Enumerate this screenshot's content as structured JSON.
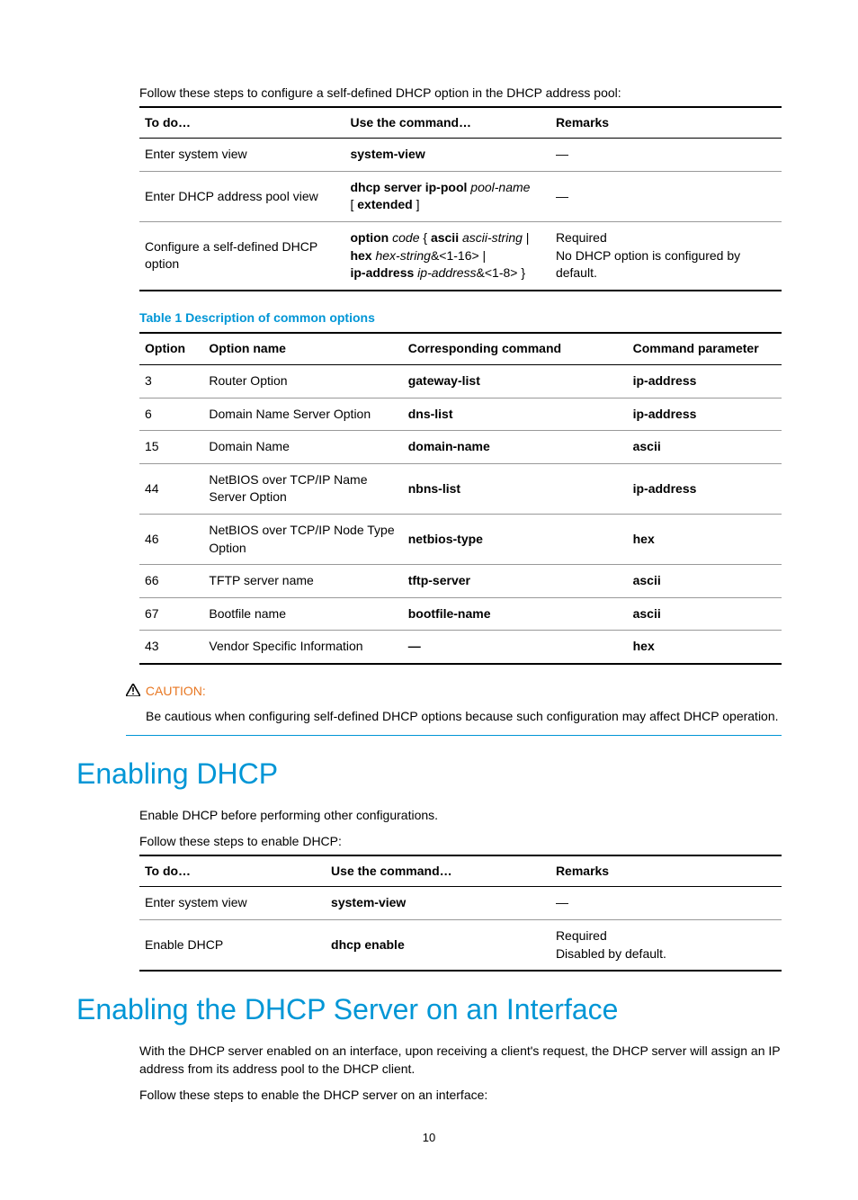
{
  "intro1": "Follow these steps to configure a self-defined DHCP option in the DHCP address pool:",
  "table1": {
    "h1": "To do…",
    "h2": "Use the command…",
    "h3": "Remarks",
    "r1c1": "Enter system view",
    "r1c2": "system-view",
    "r1c3": "—",
    "r2c1": "Enter DHCP address pool view",
    "r2c2a": "dhcp server ip-pool ",
    "r2c2b": "pool-name",
    "r2c2c": "[ ",
    "r2c2d": "extended",
    "r2c2e": " ]",
    "r2c3": "—",
    "r3c1": "Configure a self-defined DHCP option",
    "r3c2a": "option ",
    "r3c2b": "code",
    "r3c2c": " { ",
    "r3c2d": "ascii ",
    "r3c2e": "ascii-string",
    "r3c2f": " | ",
    "r3c2g": "hex ",
    "r3c2h": "hex-string",
    "r3c2i": "&<1-16> | ",
    "r3c2j": "ip-address ",
    "r3c2k": "ip-address",
    "r3c2l": "&<1-8> }",
    "r3c3a": "Required",
    "r3c3b": "No DHCP option is configured by default."
  },
  "tableCaption": "Table 1 Description of common options",
  "table2": {
    "h1": "Option",
    "h2": "Option name",
    "h3": "Corresponding command",
    "h4": "Command parameter",
    "rows": [
      {
        "c1": "3",
        "c2": "Router Option",
        "c3": "gateway-list",
        "c4": "ip-address"
      },
      {
        "c1": "6",
        "c2": "Domain Name Server Option",
        "c3": "dns-list",
        "c4": "ip-address"
      },
      {
        "c1": "15",
        "c2": "Domain Name",
        "c3": "domain-name",
        "c4": "ascii"
      },
      {
        "c1": "44",
        "c2": "NetBIOS over TCP/IP Name Server Option",
        "c3": "nbns-list",
        "c4": "ip-address"
      },
      {
        "c1": "46",
        "c2": "NetBIOS over TCP/IP Node Type Option",
        "c3": "netbios-type",
        "c4": "hex"
      },
      {
        "c1": "66",
        "c2": "TFTP server name",
        "c3": "tftp-server",
        "c4": "ascii"
      },
      {
        "c1": "67",
        "c2": "Bootfile name",
        "c3": "bootfile-name",
        "c4": "ascii"
      },
      {
        "c1": "43",
        "c2": "Vendor Specific Information",
        "c3": "—",
        "c4": "hex"
      }
    ]
  },
  "caution": {
    "label": "CAUTION:",
    "text": "Be cautious when configuring self-defined DHCP options because such configuration may affect DHCP operation."
  },
  "h1a": "Enabling DHCP",
  "p1a": "Enable DHCP before performing other configurations.",
  "p1b": "Follow these steps to enable DHCP:",
  "table3": {
    "h1": "To do…",
    "h2": "Use the command…",
    "h3": "Remarks",
    "r1c1": "Enter system view",
    "r1c2": "system-view",
    "r1c3": "—",
    "r2c1": "Enable DHCP",
    "r2c2": "dhcp enable",
    "r2c3a": "Required",
    "r2c3b": "Disabled by default."
  },
  "h1b": "Enabling the DHCP Server on an Interface",
  "p2a": "With the DHCP server enabled on an interface, upon receiving a client's request, the DHCP server will assign an IP address from its address pool to the DHCP client.",
  "p2b": "Follow these steps to enable the DHCP server on an interface:",
  "pageNum": "10"
}
